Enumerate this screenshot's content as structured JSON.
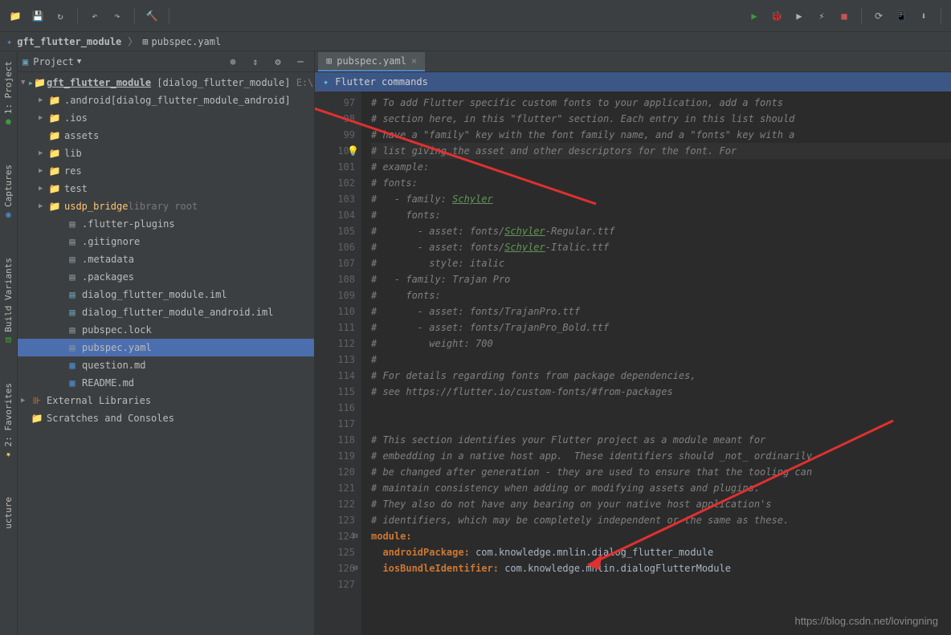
{
  "breadcrumb": {
    "project": "gft_flutter_module",
    "file": "pubspec.yaml"
  },
  "leftTabs": [
    "1: Project",
    "Captures",
    "Build Variants",
    "2: Favorites",
    "ucture"
  ],
  "projectPanel": {
    "title": "Project"
  },
  "tree": {
    "root": {
      "name": "gft_flutter_module",
      "bracket": "[dialog_flutter_module]",
      "path": "E:\\"
    },
    "items": [
      {
        "indent": 1,
        "arrow": "▶",
        "icon": "folder-blue",
        "name": ".android",
        "bracket": "[dialog_flutter_module_android]"
      },
      {
        "indent": 1,
        "arrow": "▶",
        "icon": "folder-blue",
        "name": ".ios"
      },
      {
        "indent": 1,
        "arrow": "",
        "icon": "folder",
        "name": "assets"
      },
      {
        "indent": 1,
        "arrow": "▶",
        "icon": "folder",
        "name": "lib"
      },
      {
        "indent": 1,
        "arrow": "▶",
        "icon": "folder",
        "name": "res"
      },
      {
        "indent": 1,
        "arrow": "▶",
        "icon": "folder-green",
        "name": "test"
      },
      {
        "indent": 1,
        "arrow": "▶",
        "icon": "folder-lib",
        "name": "usdp_bridge",
        "suffix": "library root"
      },
      {
        "indent": 2,
        "arrow": "",
        "icon": "file",
        "name": ".flutter-plugins"
      },
      {
        "indent": 2,
        "arrow": "",
        "icon": "file",
        "name": ".gitignore"
      },
      {
        "indent": 2,
        "arrow": "",
        "icon": "file",
        "name": ".metadata"
      },
      {
        "indent": 2,
        "arrow": "",
        "icon": "file",
        "name": ".packages"
      },
      {
        "indent": 2,
        "arrow": "",
        "icon": "file-blue",
        "name": "dialog_flutter_module.iml"
      },
      {
        "indent": 2,
        "arrow": "",
        "icon": "file-blue",
        "name": "dialog_flutter_module_android.iml"
      },
      {
        "indent": 2,
        "arrow": "",
        "icon": "file",
        "name": "pubspec.lock"
      },
      {
        "indent": 2,
        "arrow": "",
        "icon": "file",
        "name": "pubspec.yaml",
        "selected": true
      },
      {
        "indent": 2,
        "arrow": "",
        "icon": "file-md",
        "name": "question.md"
      },
      {
        "indent": 2,
        "arrow": "",
        "icon": "file-md",
        "name": "README.md"
      }
    ],
    "external": "External Libraries",
    "scratches": "Scratches and Consoles"
  },
  "editor": {
    "tab": "pubspec.yaml",
    "flutterBar": "Flutter commands",
    "startLine": 97,
    "lines": [
      "# To add Flutter specific custom fonts to your application, add a fonts",
      "# section here, in this \"flutter\" section. Each entry in this list should",
      "# have a \"family\" key with the font family name, and a \"fonts\" key with a",
      "# list giving the asset and other descriptors for the font. For",
      "# example:",
      "# fonts:",
      "#   - family: Schyler",
      "#     fonts:",
      "#       - asset: fonts/Schyler-Regular.ttf",
      "#       - asset: fonts/Schyler-Italic.ttf",
      "#         style: italic",
      "#   - family: Trajan Pro",
      "#     fonts:",
      "#       - asset: fonts/TrajanPro.ttf",
      "#       - asset: fonts/TrajanPro_Bold.ttf",
      "#         weight: 700",
      "#",
      "# For details regarding fonts from package dependencies,",
      "# see https://flutter.io/custom-fonts/#from-packages",
      "",
      "",
      "# This section identifies your Flutter project as a module meant for",
      "# embedding in a native host app.  These identifiers should _not_ ordinarily",
      "# be changed after generation - they are used to ensure that the tooling can",
      "# maintain consistency when adding or modifying assets and plugins.",
      "# They also do not have any bearing on your native host application's",
      "# identifiers, which may be completely independent or the same as these."
    ],
    "module": {
      "keyword": "module:",
      "androidKey": "androidPackage:",
      "androidVal": "com.knowledge.mnlin.dialog_flutter_module",
      "iosKey": "iosBundleIdentifier:",
      "iosVal": "com.knowledge.mnlin.dialogFlutterModule"
    }
  },
  "watermark": "https://blog.csdn.net/lovingning"
}
